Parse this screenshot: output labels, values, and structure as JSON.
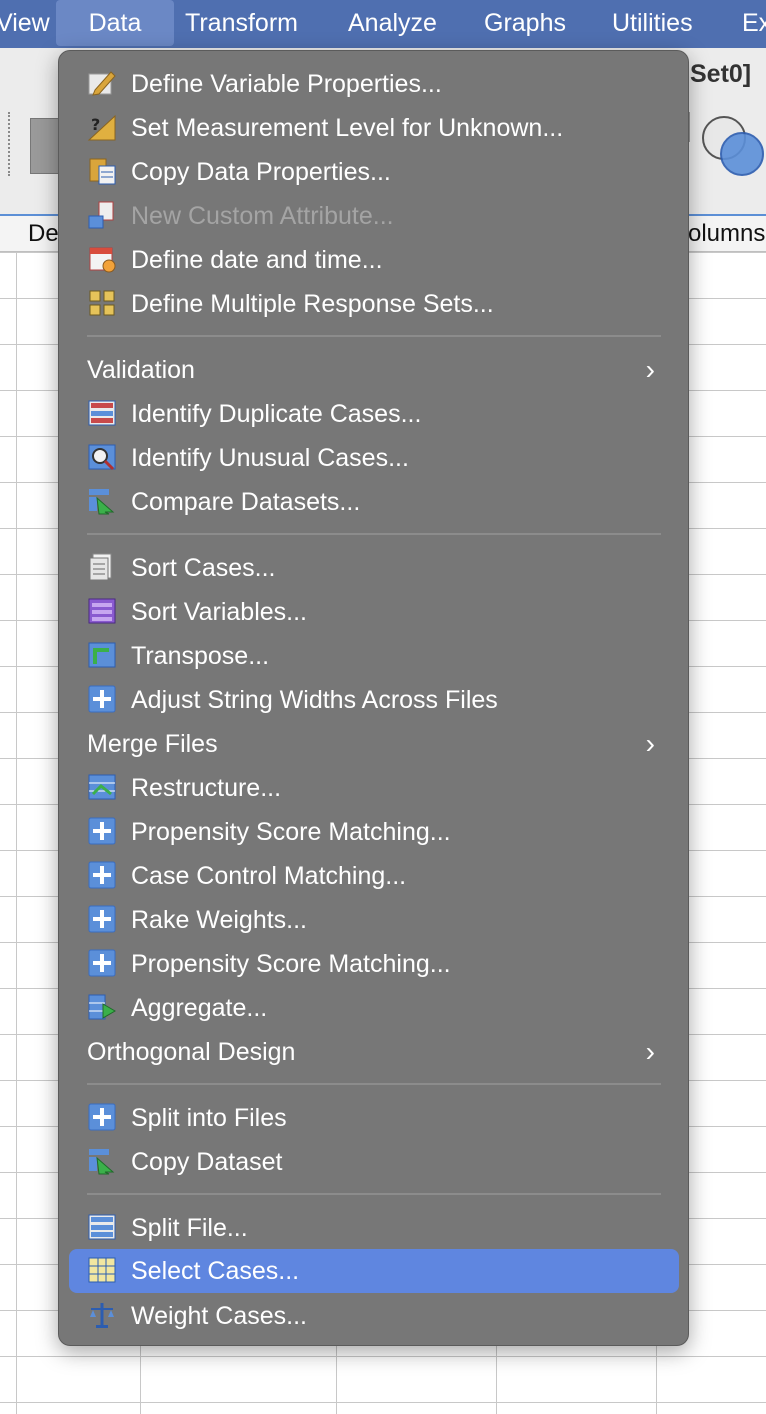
{
  "menubar": {
    "items": [
      "View",
      "Data",
      "Transform",
      "Analyze",
      "Graphs",
      "Utilities",
      "Ex"
    ],
    "active": "Data"
  },
  "window": {
    "title_fragment": "Set0]",
    "col_left": "De",
    "col_right": "olumns"
  },
  "menu": {
    "items": [
      {
        "label": "Define Variable Properties...",
        "icon": "pencil-icon"
      },
      {
        "label": "Set Measurement Level for Unknown...",
        "icon": "measure-icon"
      },
      {
        "label": "Copy Data Properties...",
        "icon": "copy-properties-icon"
      },
      {
        "label": "New Custom Attribute...",
        "icon": "attribute-icon",
        "disabled": true
      },
      {
        "label": "Define date and time...",
        "icon": "calendar-icon"
      },
      {
        "label": "Define Multiple Response Sets...",
        "icon": "grid4-icon"
      },
      {
        "label": "Validation",
        "submenu": true
      },
      {
        "label": "Identify Duplicate Cases...",
        "icon": "duplicate-icon"
      },
      {
        "label": "Identify Unusual Cases...",
        "icon": "magnifier-icon"
      },
      {
        "label": "Compare Datasets...",
        "icon": "compare-icon"
      },
      {
        "label": "Sort Cases...",
        "icon": "sort-cases-icon"
      },
      {
        "label": "Sort Variables...",
        "icon": "sort-variables-icon"
      },
      {
        "label": "Transpose...",
        "icon": "transpose-icon"
      },
      {
        "label": "Adjust String Widths Across Files",
        "icon": "plus-icon"
      },
      {
        "label": "Merge Files",
        "submenu": true
      },
      {
        "label": "Restructure...",
        "icon": "restructure-icon"
      },
      {
        "label": "Propensity Score Matching...",
        "icon": "plus-icon"
      },
      {
        "label": "Case Control Matching...",
        "icon": "plus-icon"
      },
      {
        "label": "Rake Weights...",
        "icon": "plus-icon"
      },
      {
        "label": "Propensity Score Matching...",
        "icon": "plus-icon"
      },
      {
        "label": "Aggregate...",
        "icon": "aggregate-icon"
      },
      {
        "label": "Orthogonal Design",
        "submenu": true
      },
      {
        "label": "Split into Files",
        "icon": "plus-icon"
      },
      {
        "label": "Copy Dataset",
        "icon": "compare-icon"
      },
      {
        "label": "Split File...",
        "icon": "split-file-icon"
      },
      {
        "label": "Select Cases...",
        "icon": "select-cases-icon",
        "selected": true
      },
      {
        "label": "Weight Cases...",
        "icon": "scale-icon"
      }
    ],
    "submenu_glyph": "›"
  },
  "colors": {
    "menubar": "#4f6fb0",
    "menu_bg": "#777777",
    "selection": "#5f86e0",
    "separator": "#8c8c8c"
  }
}
